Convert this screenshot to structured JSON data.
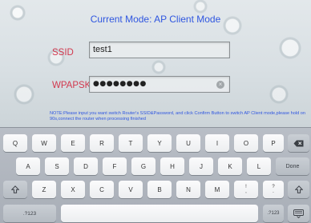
{
  "title": "Current Mode: AP Client Mode",
  "ssid": {
    "label": "SSID",
    "value": "test1"
  },
  "wpapsk": {
    "label": "WPAPSK",
    "masked_value": "●●●●●●●●"
  },
  "note": "NOTE:Please input you want switch Router's SSID&Password, and click Confirm Button to switch AP Client mode,please hold on 90s,connect the router when processing finished",
  "colors": {
    "title": "#2f56e0",
    "label": "#d2384e",
    "note": "#2f56e0"
  },
  "keyboard": {
    "row1": [
      "Q",
      "W",
      "E",
      "R",
      "T",
      "Y",
      "U",
      "I",
      "O",
      "P"
    ],
    "row2": [
      "A",
      "S",
      "D",
      "F",
      "G",
      "H",
      "J",
      "K",
      "L"
    ],
    "row3": [
      "Z",
      "X",
      "C",
      "V",
      "B",
      "N",
      "M"
    ],
    "row3_punct": [
      {
        "top": "!",
        "bottom": ","
      },
      {
        "top": "?",
        "bottom": "."
      }
    ],
    "done_label": "Done",
    "numbers_label": ".?123",
    "numbers_label_right": ".?123",
    "icons": {
      "backspace": "backspace-icon",
      "shift": "shift-icon",
      "hide_keyboard": "keyboard-hide-icon"
    }
  }
}
